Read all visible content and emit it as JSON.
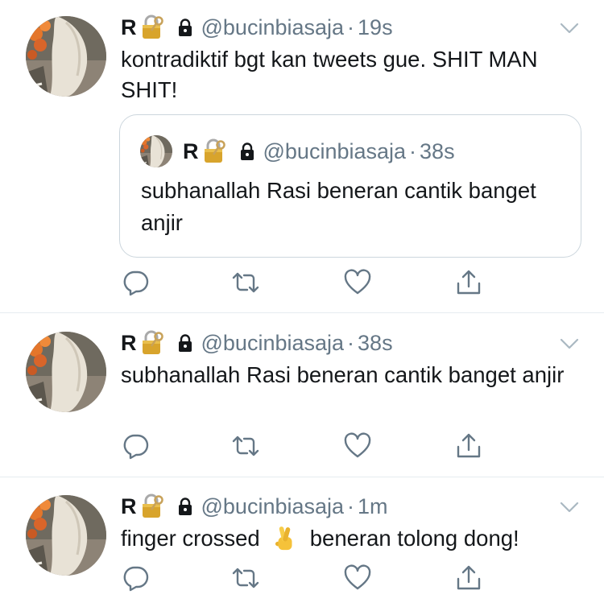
{
  "tweets": [
    {
      "name": "R",
      "handle": "@bucinbiasaja",
      "separator": "·",
      "time": "19s",
      "text": "kontradiktif bgt kan tweets gue. SHIT MAN SHIT!",
      "quote": {
        "name": "R",
        "handle": "@bucinbiasaja",
        "separator": "·",
        "time": "38s",
        "text": "subhanallah Rasi beneran cantik banget anjir"
      }
    },
    {
      "name": "R",
      "handle": "@bucinbiasaja",
      "separator": "·",
      "time": "38s",
      "text": "subhanallah Rasi beneran cantik banget anjir"
    },
    {
      "name": "R",
      "handle": "@bucinbiasaja",
      "separator": "·",
      "time": "1m",
      "text_before": "finger crossed",
      "text_after": "beneran tolong dong!"
    }
  ],
  "icons": {
    "name_emoji": "lock-with-key-icon",
    "protected": "lock-icon",
    "menu": "chevron-down-icon",
    "reply": "reply-icon",
    "retweet": "retweet-icon",
    "like": "heart-icon",
    "share": "share-icon",
    "text_emoji": "crossed-fingers-icon"
  },
  "colors": {
    "text": "#14171a",
    "secondary": "#657786",
    "divider": "#e6ecf0",
    "quote_border": "#ccd6dd",
    "lock_gold": "#d8a42c"
  }
}
